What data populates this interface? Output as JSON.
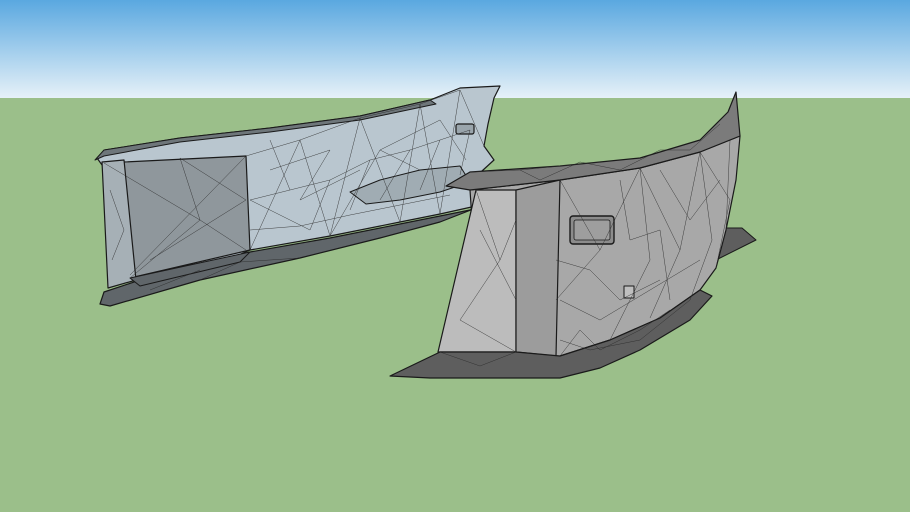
{
  "viewport": {
    "sky_top_color": "#5aa8e0",
    "sky_horizon_color": "#e6f1f8",
    "ground_color": "#9bbf8a"
  },
  "model": {
    "left_part": {
      "outer_face_color": "#b9c6cf",
      "inner_face_color": "#8f979c",
      "underside_color": "#60666a",
      "edge_color": "#1a1a1a"
    },
    "right_part": {
      "face_color": "#a8a8a8",
      "top_color": "#7b7b7b",
      "dark_color": "#5e5e5e",
      "edge_color": "#1a1a1a"
    }
  }
}
